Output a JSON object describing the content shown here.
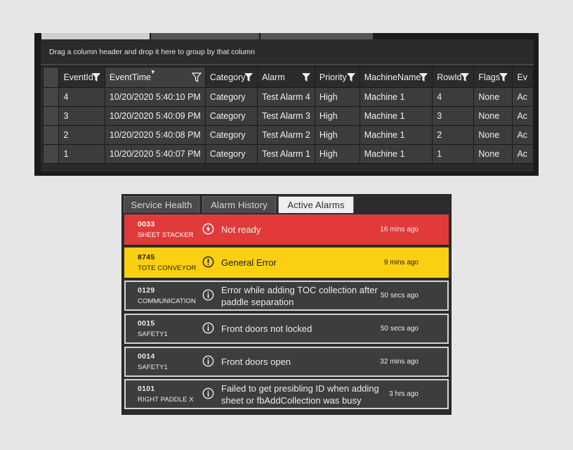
{
  "grid": {
    "group_hint": "Drag a column header and drop it here to group by that column",
    "columns": [
      "EventId",
      "EventTime",
      "Category",
      "Alarm",
      "Priority",
      "MachineName",
      "RowId",
      "Flags",
      "Ev"
    ],
    "rows": [
      [
        "4",
        "10/20/2020 5:40:10 PM",
        "Category",
        "Test Alarm 4",
        "High",
        "Machine 1",
        "4",
        "None",
        "Ac"
      ],
      [
        "3",
        "10/20/2020 5:40:09 PM",
        "Category",
        "Test Alarm 3",
        "High",
        "Machine 1",
        "3",
        "None",
        "Ac"
      ],
      [
        "2",
        "10/20/2020 5:40:08 PM",
        "Category",
        "Test Alarm 2",
        "High",
        "Machine 1",
        "2",
        "None",
        "Ac"
      ],
      [
        "1",
        "10/20/2020 5:40:07 PM",
        "Category",
        "Test Alarm 1",
        "High",
        "Machine 1",
        "1",
        "None",
        "Ac"
      ]
    ],
    "sorted_column": "EventTime",
    "sort_direction": "descending"
  },
  "alarms": {
    "tabs": [
      "Service Health",
      "Alarm History",
      "Active Alarms"
    ],
    "active_tab": "Active Alarms",
    "items": [
      {
        "code": "0033",
        "source": "SHEET STACKER",
        "message": "Not ready",
        "time_num": "16",
        "time_unit": "mins ago",
        "severity": "error",
        "icon": "lightning-icon"
      },
      {
        "code": "8745",
        "source": "TOTE CONVEYOR",
        "message": "General Error",
        "time_num": "9",
        "time_unit": "mins ago",
        "severity": "warning",
        "icon": "exclamation-icon"
      },
      {
        "code": "0129",
        "source": "COMMUNICATION",
        "message": "Error while adding TOC collection after paddle separation",
        "time_num": "50",
        "time_unit": "secs ago",
        "severity": "info",
        "icon": "info-icon"
      },
      {
        "code": "0015",
        "source": "SAFETY1",
        "message": "Front doors not locked",
        "time_num": "50",
        "time_unit": "secs ago",
        "severity": "info",
        "icon": "info-icon"
      },
      {
        "code": "0014",
        "source": "SAFETY1",
        "message": "Front doors open",
        "time_num": "32",
        "time_unit": "mins ago",
        "severity": "info",
        "icon": "info-icon"
      },
      {
        "code": "0101",
        "source": "RIGHT PADDLE X",
        "message": "Failed to get presibling ID when adding sheet or fbAddCollection was busy",
        "time_num": "3",
        "time_unit": "hrs ago",
        "severity": "info",
        "icon": "info-icon"
      }
    ]
  },
  "colors": {
    "error": "#e23a3a",
    "warning": "#fbd012",
    "info": "#3d3d3d",
    "grid_bg": "#2b2b2b"
  }
}
